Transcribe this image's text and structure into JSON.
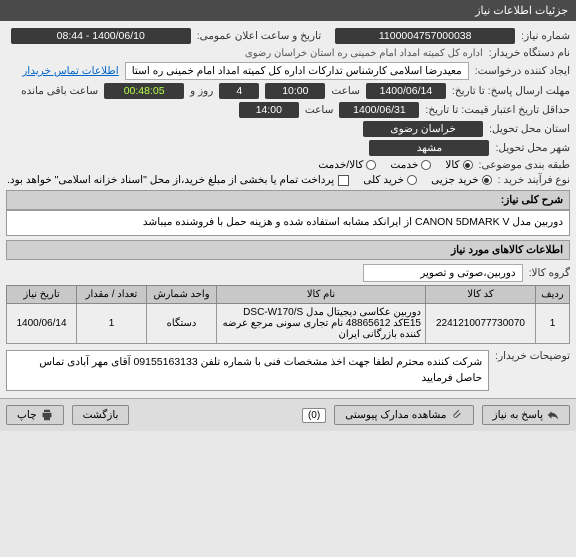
{
  "titlebar": "جزئیات اطلاعات نیاز",
  "labels": {
    "need_no": "شماره نیاز:",
    "pub_datetime": "تاریخ و ساعت اعلان عمومی:",
    "buyer": "نام دستگاه خریدار:",
    "requester": "ایجاد کننده درخواست:",
    "contact": "اطلاعات تماس خریدار",
    "deadline": "مهلت ارسال پاسخ: تا تاریخ:",
    "hour": "ساعت",
    "dayand": "روز و",
    "remaining": "ساعت باقی مانده",
    "validity": "حداقل تاریخ اعتبار قیمت: تا تاریخ:",
    "province": "استان محل تحویل:",
    "city": "شهر محل تحویل:",
    "category": "طبقه بندی موضوعی:",
    "purchase_type": "نوع فرآیند خرید :",
    "purchase_note": "پرداخت تمام یا بخشی از مبلغ خرید،از محل \"اسناد خزانه اسلامی\" خواهد بود.",
    "need_desc_h": "شرح کلی نیاز:",
    "items_h": "اطلاعات کالاهای مورد نیاز",
    "group": "گروه کالا:",
    "buyer_notes_l": "توضیحات خریدار:"
  },
  "values": {
    "need_no": "1100004757000038",
    "pub_datetime": "1400/06/10 - 08:44",
    "buyer": "اداره کل کمیته امداد امام خمینی  ره  استان خراسان رضوی",
    "requester": "معیدرضا اسلامی کارشناس تدارکات اداره کل کمیته امداد امام خمینی  ره  استا",
    "deadline_date": "1400/06/14",
    "deadline_time": "10:00",
    "days": "4",
    "timer": "00:48:05",
    "validity_date": "1400/06/31",
    "validity_time": "14:00",
    "province": "خراسان رضوی",
    "city": "مشهد",
    "group": "دوربین،صوتی و تصویر"
  },
  "radios": {
    "category": [
      {
        "label": "کالا",
        "selected": true
      },
      {
        "label": "خدمت",
        "selected": false
      },
      {
        "label": "کالا/خدمت",
        "selected": false
      }
    ],
    "purchase": [
      {
        "label": "خرید جزیی",
        "selected": true
      },
      {
        "label": "خرید کلی",
        "selected": false
      }
    ]
  },
  "need_desc": "دوربین مدل CANON 5DMARK V از ایرانکد مشابه استفاده شده و هزینه حمل با فروشنده میباشد",
  "table": {
    "headers": [
      "ردیف",
      "کد کالا",
      "نام کالا",
      "واحد شمارش",
      "تعداد / مقدار",
      "تاریخ نیاز"
    ],
    "row": {
      "idx": "1",
      "code": "2241210077730070",
      "name": "دوربین عکاسی دیجیتال مدل DSC-W170/S E15کد 48865612 نام تجاری سونی مرجع عرضه کننده بازرگانی ایران",
      "unit": "دستگاه",
      "qty": "1",
      "date": "1400/06/14"
    }
  },
  "buyer_notes": "شرکت کننده محترم لطفا جهت اخذ مشخصات فنی  با شماره تلفن 09155163133 آقای مهر آبادی تماس حاصل فرمایید",
  "footer": {
    "reply": "پاسخ به نیاز",
    "view_docs": "مشاهده مدارک پیوستی",
    "attach_count": "(0)",
    "back": "بازگشت",
    "print": "چاپ"
  }
}
